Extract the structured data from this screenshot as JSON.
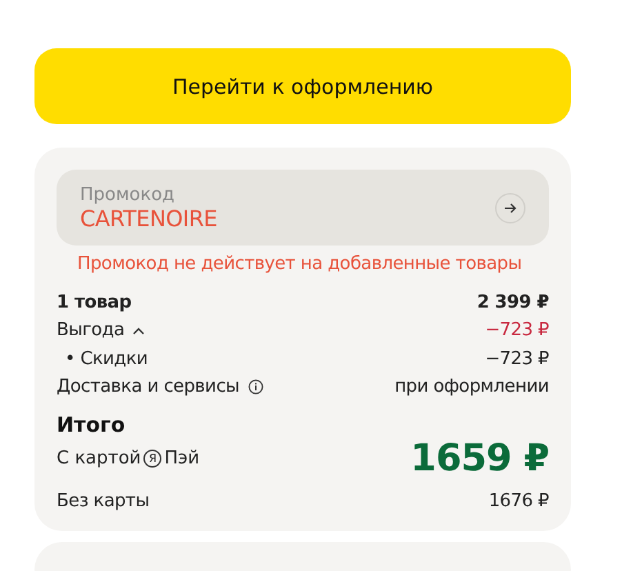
{
  "checkout_button": "Перейти к оформлению",
  "promo": {
    "placeholder": "Промокод",
    "value": "CARTENOIRE",
    "error": "Промокод не действует на добавленные товары"
  },
  "summary": [
    {
      "kind": "bold",
      "label": "1 товар",
      "value": "2 399 ₽"
    },
    {
      "kind": "benefit",
      "label": "Выгода",
      "value": "−723 ₽",
      "expanded": true
    },
    {
      "kind": "sub",
      "label": "• Скидки",
      "value": "−723 ₽"
    },
    {
      "kind": "info",
      "label": "Доставка и сервисы",
      "value": "при оформлении"
    }
  ],
  "total": {
    "title": "Итого",
    "card_label_before": "С картой",
    "card_logo": "Я",
    "card_label_after": "Пэй",
    "card_price": "1659 ₽",
    "no_card_label": "Без карты",
    "no_card_price": "1676 ₽"
  }
}
